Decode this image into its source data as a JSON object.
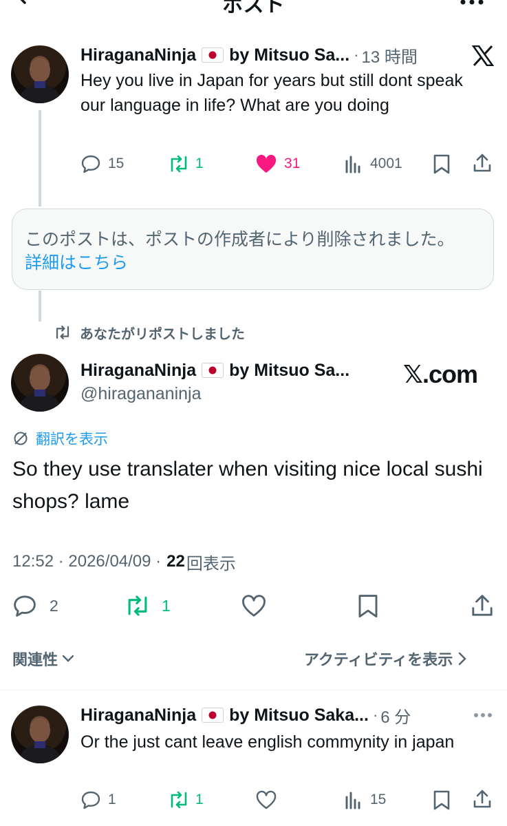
{
  "header": {
    "title": "ポスト"
  },
  "post1": {
    "author": "HiraganaNinja",
    "author_suffix": "by Mitsuo Sa...",
    "separator": "·",
    "time": "13 時間",
    "text": "Hey you live in Japan for years but still dont speak our language in life? What are you doing",
    "stats": {
      "replies": "15",
      "reposts": "1",
      "likes": "31",
      "views": "4001"
    }
  },
  "deleted_notice": {
    "text": "このポストは、ポストの作成者により削除されました。",
    "link": "詳細はこちら"
  },
  "repost_banner": {
    "text": "あなたがリポストしました"
  },
  "main_post": {
    "author": "HiraganaNinja",
    "author_suffix": "by Mitsuo Sa...",
    "handle": "@hiragananinja",
    "translate": "翻訳を表示",
    "text": "So they use translater when visiting nice local sushi shops? lame",
    "timestamp": "12:52 · 2026/04/09 ·",
    "views_count": "22",
    "views_label": "回表示",
    "stats": {
      "replies": "2",
      "reposts": "1"
    },
    "watermark": "𝕏.com"
  },
  "reply_bar": {
    "sort": "関連性",
    "activity": "アクティビティを表示"
  },
  "reply": {
    "author": "HiraganaNinja",
    "author_suffix": "by Mitsuo Saka...",
    "separator": "·",
    "time": "6 分",
    "text": "Or the just cant leave english commynity in japan",
    "stats": {
      "replies": "1",
      "reposts": "1",
      "views": "15"
    }
  },
  "colors": {
    "repost_green": "#00ba7c",
    "like_pink": "#f91880",
    "link_blue": "#1d9bf0",
    "secondary_gray": "#536471"
  }
}
